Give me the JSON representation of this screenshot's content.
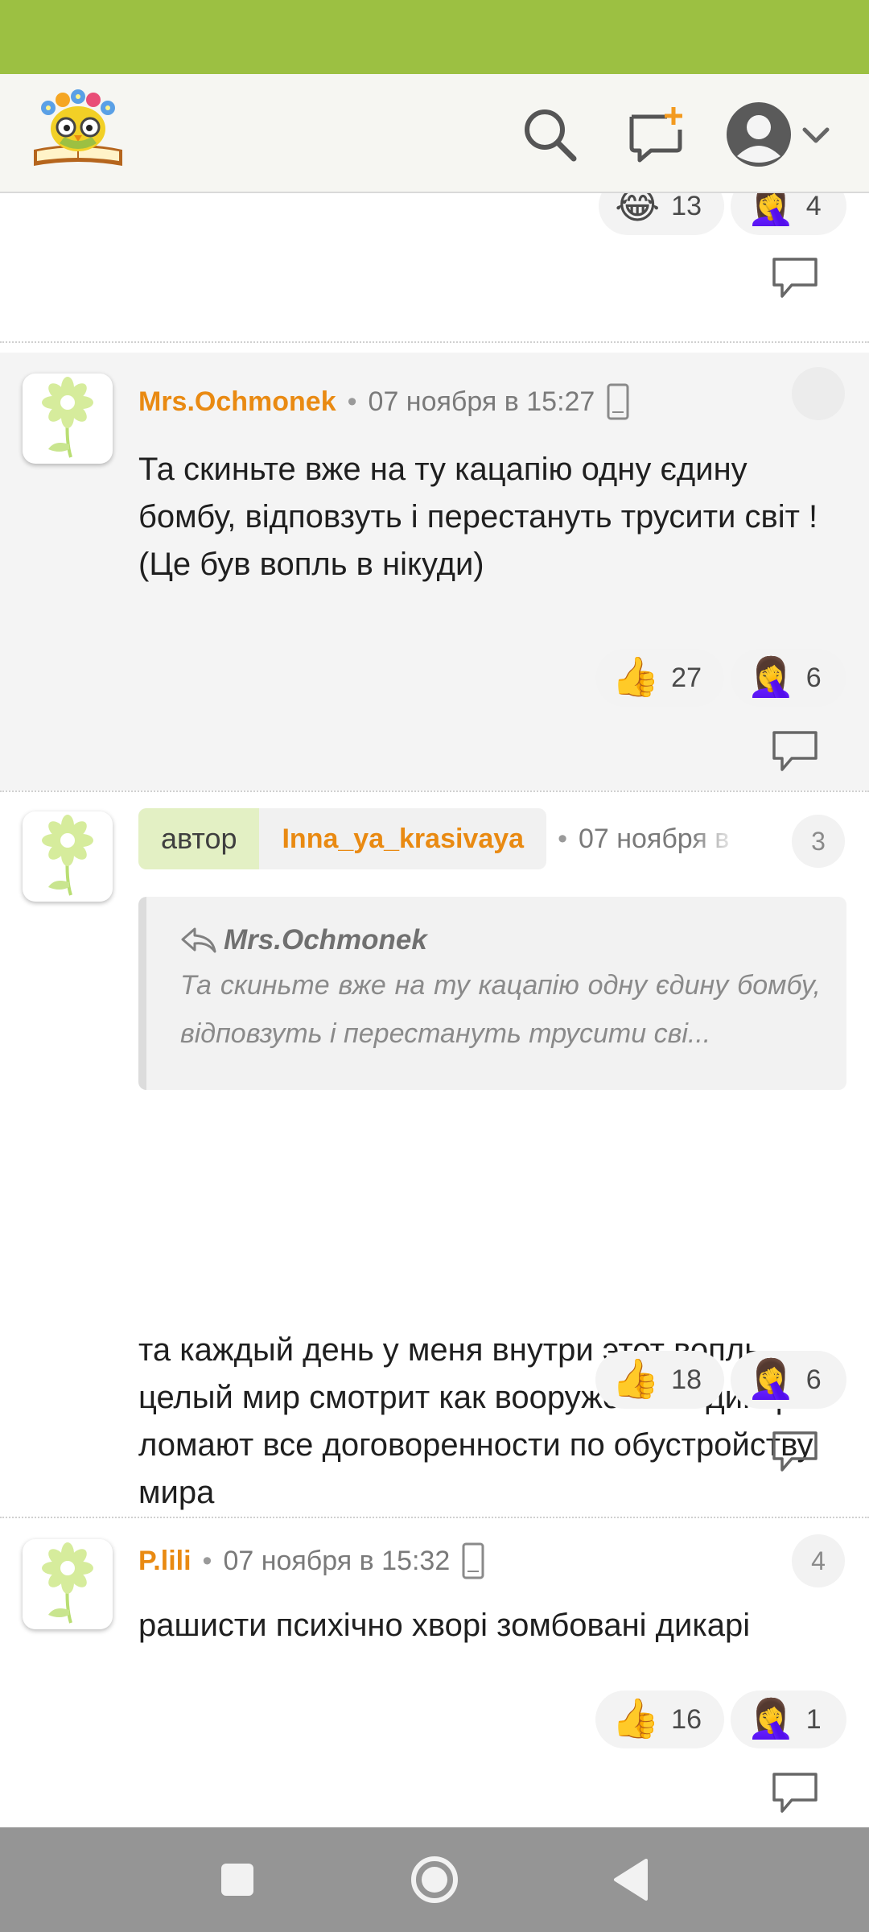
{
  "header": {
    "icons": [
      "logo-owl-icon",
      "search-icon",
      "new-message-icon",
      "avatar-icon",
      "chevron-down-icon"
    ]
  },
  "top_partial": {
    "reactions": [
      {
        "emoji": "😂",
        "count": "13"
      },
      {
        "emoji": "🤦‍♀️",
        "count": "4"
      }
    ]
  },
  "comments": [
    {
      "author": "Mrs.Ochmonek",
      "date": "07 ноября в 15:27",
      "counter": "",
      "text": "Та скиньте вже на ту кацапію одну єдину бомбу, відповзуть і перестануть трусити світ ! (Це був вопль в нікуди)",
      "reactions": [
        {
          "emoji": "👍",
          "count": "27"
        },
        {
          "emoji": "🤦‍♀️",
          "count": "6"
        }
      ]
    },
    {
      "author_label": "автор",
      "author": "Inna_ya_krasivaya",
      "date": "07 ноября в",
      "counter": "3",
      "quote": {
        "author": "Mrs.Ochmonek",
        "text": "Та скиньте вже на ту кацапію одну єдину бомбу, відповзуть і перестануть трусити сві..."
      },
      "text": "та каждый день у меня внутри этот вопль целый мир смотрит как вооруженные дикари ломают все договоренности по обустройству мира",
      "reactions": [
        {
          "emoji": "👍",
          "count": "18"
        },
        {
          "emoji": "🤦‍♀️",
          "count": "6"
        }
      ]
    },
    {
      "author": "P.lili",
      "date": "07 ноября в 15:32",
      "counter": "4",
      "text": "рашисти психічно хворі зомбовані дикарі",
      "reactions": [
        {
          "emoji": "👍",
          "count": "16"
        },
        {
          "emoji": "🤦‍♀️",
          "count": "1"
        }
      ]
    }
  ],
  "colors": {
    "status_bar": "#9cc042",
    "author_name": "#e98a12",
    "author_badge_bg": "#e3f0c4",
    "nav_bar": "#959595"
  }
}
